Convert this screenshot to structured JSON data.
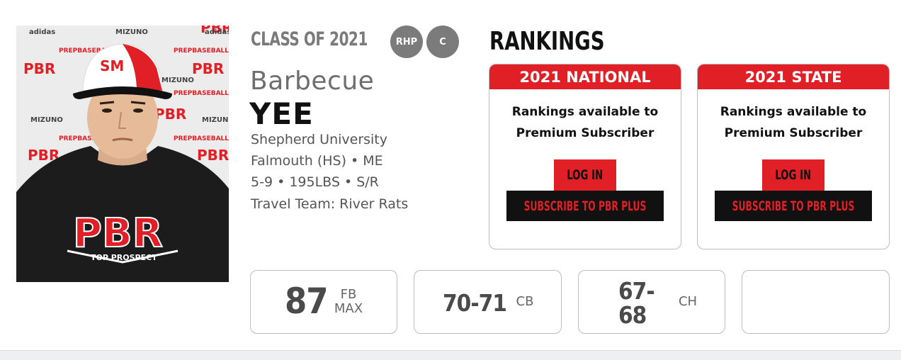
{
  "player": {
    "class_of": "CLASS OF 2021",
    "positions": [
      "RHP",
      "C"
    ],
    "first_name": "Barbecue",
    "last_name": "YEE",
    "college": "Shepherd University",
    "high_school": "Falmouth (HS) • ME",
    "measurables": "5-9 • 195LBS • S/R",
    "travel_team": "Travel Team: River Rats",
    "photo": {
      "logos": [
        "PBR",
        "PREPBASEBALL",
        "adidas",
        "MIZUNO"
      ],
      "cap_logo": "SM",
      "shirt_logo": "PBR",
      "shirt_tagline": "TOP PROSPECT"
    }
  },
  "rankings": {
    "title": "RANKINGS",
    "cards": [
      {
        "heading": "2021 NATIONAL",
        "message_line1": "Rankings available to",
        "message_line2": "Premium Subscriber",
        "login_label": "LOG IN",
        "subscribe_label": "SUBSCRIBE TO PBR PLUS"
      },
      {
        "heading": "2021 STATE",
        "message_line1": "Rankings available to",
        "message_line2": "Premium Subscriber",
        "login_label": "LOG IN",
        "subscribe_label": "SUBSCRIBE TO PBR PLUS"
      }
    ]
  },
  "stats": [
    {
      "value": "87",
      "label_line1": "FB",
      "label_line2": "MAX"
    },
    {
      "value": "70-71",
      "label_line1": "CB",
      "label_line2": ""
    },
    {
      "value_line1": "67-",
      "value_line2": "68",
      "label_line1": "CH",
      "label_line2": ""
    },
    {
      "value": "",
      "label_line1": "",
      "label_line2": ""
    }
  ],
  "colors": {
    "accent_red": "#e01f26",
    "badge_gray": "#7b7b7b",
    "text_dark": "#111111",
    "text_gray": "#555555"
  }
}
